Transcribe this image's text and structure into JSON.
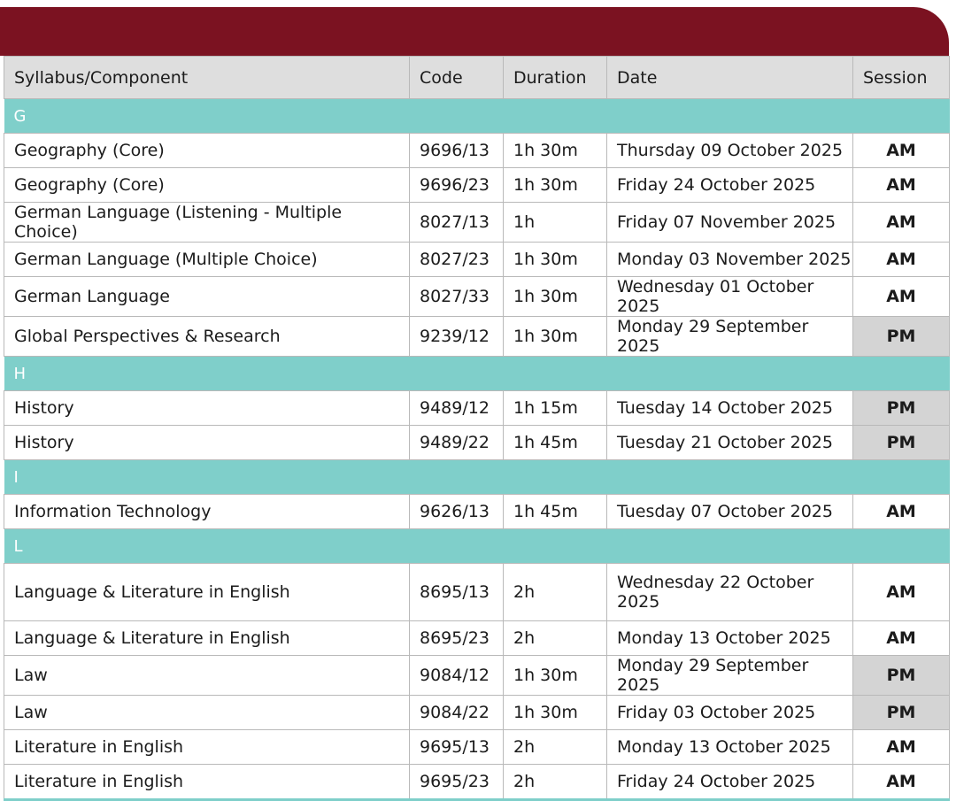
{
  "table": {
    "headers": [
      "Syllabus/Component",
      "Code",
      "Duration",
      "Date",
      "Session"
    ],
    "groups": [
      {
        "letter": "G",
        "rows": [
          [
            "Geography (Core)",
            "9696/13",
            "1h 30m",
            "Thursday 09 October 2025",
            "AM"
          ],
          [
            "Geography (Core)",
            "9696/23",
            "1h 30m",
            "Friday 24 October 2025",
            "AM"
          ],
          [
            "German Language (Listening - Multiple Choice)",
            "8027/13",
            "1h",
            "Friday 07 November 2025",
            "AM"
          ],
          [
            "German Language (Multiple Choice)",
            "8027/23",
            "1h 30m",
            "Monday 03 November 2025",
            "AM"
          ],
          [
            "German Language",
            "8027/33",
            "1h 30m",
            "Wednesday 01 October 2025",
            "AM"
          ],
          [
            "Global Perspectives & Research",
            "9239/12",
            "1h 30m",
            "Monday 29 September 2025",
            "PM"
          ]
        ]
      },
      {
        "letter": "H",
        "rows": [
          [
            "History",
            "9489/12",
            "1h 15m",
            "Tuesday 14 October 2025",
            "PM"
          ],
          [
            "History",
            "9489/22",
            "1h 45m",
            "Tuesday 21 October 2025",
            "PM"
          ]
        ]
      },
      {
        "letter": "I",
        "rows": [
          [
            "Information Technology",
            "9626/13",
            "1h 45m",
            "Tuesday 07 October 2025",
            "AM"
          ]
        ]
      },
      {
        "letter": "L",
        "rows": [
          [
            "Language & Literature in English",
            "8695/13",
            "2h",
            "Wednesday 22 October 2025",
            "AM"
          ],
          [
            "Language & Literature in English",
            "8695/23",
            "2h",
            "Monday 13 October 2025",
            "AM"
          ],
          [
            "Law",
            "9084/12",
            "1h 30m",
            "Monday 29 September 2025",
            "PM"
          ],
          [
            "Law",
            "9084/22",
            "1h 30m",
            "Friday 03 October 2025",
            "PM"
          ],
          [
            "Literature in English",
            "9695/13",
            "2h",
            "Monday 13 October 2025",
            "AM"
          ],
          [
            "Literature in English",
            "9695/23",
            "2h",
            "Friday 24 October 2025",
            "AM"
          ]
        ]
      }
    ]
  },
  "colors": {
    "banner": "#7b1221",
    "letter_row": "#7fcfca",
    "header": "#dedede",
    "pm_cell": "#d4d4d4"
  }
}
